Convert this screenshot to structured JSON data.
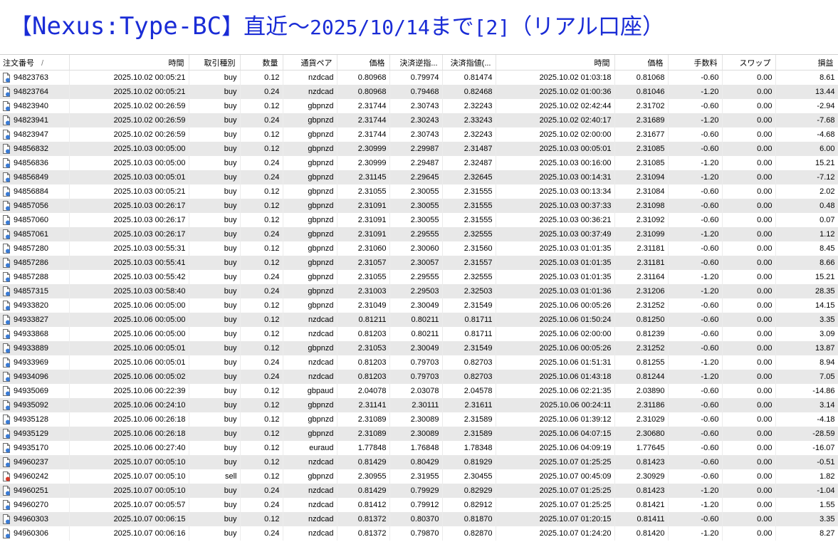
{
  "title": {
    "bracket_open": "【",
    "name": "Nexus:Type-BC",
    "bracket_close": "】",
    "prefix": "直近～",
    "date": "2025/10/14",
    "suffix": "まで",
    "page": "[2]",
    "paren_open": "（",
    "account": "リアル口座",
    "paren_close": "）"
  },
  "colors": {
    "title": "#1a2cd6",
    "buy_icon": "#3a7bd5",
    "sell_icon": "#d83a2a",
    "row_alt": "#e8e8e8"
  },
  "columns": {
    "order": "注文番号",
    "sort_indicator": "/",
    "open_time": "時間",
    "type": "取引種別",
    "volume": "数量",
    "symbol": "通貨ペア",
    "open_price": "価格",
    "sl": "決済逆指...",
    "tp": "決済指値(...",
    "close_time": "時間",
    "close_price": "価格",
    "commission": "手数料",
    "swap": "スワップ",
    "profit": "損益"
  },
  "rows": [
    {
      "order": "94823763",
      "open_time": "2025.10.02 00:05:21",
      "type": "buy",
      "volume": "0.12",
      "symbol": "nzdcad",
      "open_price": "0.80968",
      "sl": "0.79974",
      "tp": "0.81474",
      "close_time": "2025.10.02 01:03:18",
      "close_price": "0.81068",
      "commission": "-0.60",
      "swap": "0.00",
      "profit": "8.61",
      "icon": "buy-icon"
    },
    {
      "order": "94823764",
      "open_time": "2025.10.02 00:05:21",
      "type": "buy",
      "volume": "0.24",
      "symbol": "nzdcad",
      "open_price": "0.80968",
      "sl": "0.79468",
      "tp": "0.82468",
      "close_time": "2025.10.02 01:00:36",
      "close_price": "0.81046",
      "commission": "-1.20",
      "swap": "0.00",
      "profit": "13.44",
      "icon": "buy-icon"
    },
    {
      "order": "94823940",
      "open_time": "2025.10.02 00:26:59",
      "type": "buy",
      "volume": "0.12",
      "symbol": "gbpnzd",
      "open_price": "2.31744",
      "sl": "2.30743",
      "tp": "2.32243",
      "close_time": "2025.10.02 02:42:44",
      "close_price": "2.31702",
      "commission": "-0.60",
      "swap": "0.00",
      "profit": "-2.94",
      "icon": "buy-icon"
    },
    {
      "order": "94823941",
      "open_time": "2025.10.02 00:26:59",
      "type": "buy",
      "volume": "0.24",
      "symbol": "gbpnzd",
      "open_price": "2.31744",
      "sl": "2.30243",
      "tp": "2.33243",
      "close_time": "2025.10.02 02:40:17",
      "close_price": "2.31689",
      "commission": "-1.20",
      "swap": "0.00",
      "profit": "-7.68",
      "icon": "buy-icon"
    },
    {
      "order": "94823947",
      "open_time": "2025.10.02 00:26:59",
      "type": "buy",
      "volume": "0.12",
      "symbol": "gbpnzd",
      "open_price": "2.31744",
      "sl": "2.30743",
      "tp": "2.32243",
      "close_time": "2025.10.02 02:00:00",
      "close_price": "2.31677",
      "commission": "-0.60",
      "swap": "0.00",
      "profit": "-4.68",
      "icon": "buy-icon"
    },
    {
      "order": "94856832",
      "open_time": "2025.10.03 00:05:00",
      "type": "buy",
      "volume": "0.12",
      "symbol": "gbpnzd",
      "open_price": "2.30999",
      "sl": "2.29987",
      "tp": "2.31487",
      "close_time": "2025.10.03 00:05:01",
      "close_price": "2.31085",
      "commission": "-0.60",
      "swap": "0.00",
      "profit": "6.00",
      "icon": "buy-icon"
    },
    {
      "order": "94856836",
      "open_time": "2025.10.03 00:05:00",
      "type": "buy",
      "volume": "0.24",
      "symbol": "gbpnzd",
      "open_price": "2.30999",
      "sl": "2.29487",
      "tp": "2.32487",
      "close_time": "2025.10.03 00:16:00",
      "close_price": "2.31085",
      "commission": "-1.20",
      "swap": "0.00",
      "profit": "15.21",
      "icon": "buy-icon"
    },
    {
      "order": "94856849",
      "open_time": "2025.10.03 00:05:01",
      "type": "buy",
      "volume": "0.24",
      "symbol": "gbpnzd",
      "open_price": "2.31145",
      "sl": "2.29645",
      "tp": "2.32645",
      "close_time": "2025.10.03 00:14:31",
      "close_price": "2.31094",
      "commission": "-1.20",
      "swap": "0.00",
      "profit": "-7.12",
      "icon": "buy-icon"
    },
    {
      "order": "94856884",
      "open_time": "2025.10.03 00:05:21",
      "type": "buy",
      "volume": "0.12",
      "symbol": "gbpnzd",
      "open_price": "2.31055",
      "sl": "2.30055",
      "tp": "2.31555",
      "close_time": "2025.10.03 00:13:34",
      "close_price": "2.31084",
      "commission": "-0.60",
      "swap": "0.00",
      "profit": "2.02",
      "icon": "buy-icon"
    },
    {
      "order": "94857056",
      "open_time": "2025.10.03 00:26:17",
      "type": "buy",
      "volume": "0.12",
      "symbol": "gbpnzd",
      "open_price": "2.31091",
      "sl": "2.30055",
      "tp": "2.31555",
      "close_time": "2025.10.03 00:37:33",
      "close_price": "2.31098",
      "commission": "-0.60",
      "swap": "0.00",
      "profit": "0.48",
      "icon": "buy-icon"
    },
    {
      "order": "94857060",
      "open_time": "2025.10.03 00:26:17",
      "type": "buy",
      "volume": "0.12",
      "symbol": "gbpnzd",
      "open_price": "2.31091",
      "sl": "2.30055",
      "tp": "2.31555",
      "close_time": "2025.10.03 00:36:21",
      "close_price": "2.31092",
      "commission": "-0.60",
      "swap": "0.00",
      "profit": "0.07",
      "icon": "buy-icon"
    },
    {
      "order": "94857061",
      "open_time": "2025.10.03 00:26:17",
      "type": "buy",
      "volume": "0.24",
      "symbol": "gbpnzd",
      "open_price": "2.31091",
      "sl": "2.29555",
      "tp": "2.32555",
      "close_time": "2025.10.03 00:37:49",
      "close_price": "2.31099",
      "commission": "-1.20",
      "swap": "0.00",
      "profit": "1.12",
      "icon": "buy-icon"
    },
    {
      "order": "94857280",
      "open_time": "2025.10.03 00:55:31",
      "type": "buy",
      "volume": "0.12",
      "symbol": "gbpnzd",
      "open_price": "2.31060",
      "sl": "2.30060",
      "tp": "2.31560",
      "close_time": "2025.10.03 01:01:35",
      "close_price": "2.31181",
      "commission": "-0.60",
      "swap": "0.00",
      "profit": "8.45",
      "icon": "buy-icon"
    },
    {
      "order": "94857286",
      "open_time": "2025.10.03 00:55:41",
      "type": "buy",
      "volume": "0.12",
      "symbol": "gbpnzd",
      "open_price": "2.31057",
      "sl": "2.30057",
      "tp": "2.31557",
      "close_time": "2025.10.03 01:01:35",
      "close_price": "2.31181",
      "commission": "-0.60",
      "swap": "0.00",
      "profit": "8.66",
      "icon": "buy-icon"
    },
    {
      "order": "94857288",
      "open_time": "2025.10.03 00:55:42",
      "type": "buy",
      "volume": "0.24",
      "symbol": "gbpnzd",
      "open_price": "2.31055",
      "sl": "2.29555",
      "tp": "2.32555",
      "close_time": "2025.10.03 01:01:35",
      "close_price": "2.31164",
      "commission": "-1.20",
      "swap": "0.00",
      "profit": "15.21",
      "icon": "buy-icon"
    },
    {
      "order": "94857315",
      "open_time": "2025.10.03 00:58:40",
      "type": "buy",
      "volume": "0.24",
      "symbol": "gbpnzd",
      "open_price": "2.31003",
      "sl": "2.29503",
      "tp": "2.32503",
      "close_time": "2025.10.03 01:01:36",
      "close_price": "2.31206",
      "commission": "-1.20",
      "swap": "0.00",
      "profit": "28.35",
      "icon": "buy-icon"
    },
    {
      "order": "94933820",
      "open_time": "2025.10.06 00:05:00",
      "type": "buy",
      "volume": "0.12",
      "symbol": "gbpnzd",
      "open_price": "2.31049",
      "sl": "2.30049",
      "tp": "2.31549",
      "close_time": "2025.10.06 00:05:26",
      "close_price": "2.31252",
      "commission": "-0.60",
      "swap": "0.00",
      "profit": "14.15",
      "icon": "buy-icon"
    },
    {
      "order": "94933827",
      "open_time": "2025.10.06 00:05:00",
      "type": "buy",
      "volume": "0.12",
      "symbol": "nzdcad",
      "open_price": "0.81211",
      "sl": "0.80211",
      "tp": "0.81711",
      "close_time": "2025.10.06 01:50:24",
      "close_price": "0.81250",
      "commission": "-0.60",
      "swap": "0.00",
      "profit": "3.35",
      "icon": "buy-icon"
    },
    {
      "order": "94933868",
      "open_time": "2025.10.06 00:05:00",
      "type": "buy",
      "volume": "0.12",
      "symbol": "nzdcad",
      "open_price": "0.81203",
      "sl": "0.80211",
      "tp": "0.81711",
      "close_time": "2025.10.06 02:00:00",
      "close_price": "0.81239",
      "commission": "-0.60",
      "swap": "0.00",
      "profit": "3.09",
      "icon": "buy-icon"
    },
    {
      "order": "94933889",
      "open_time": "2025.10.06 00:05:01",
      "type": "buy",
      "volume": "0.12",
      "symbol": "gbpnzd",
      "open_price": "2.31053",
      "sl": "2.30049",
      "tp": "2.31549",
      "close_time": "2025.10.06 00:05:26",
      "close_price": "2.31252",
      "commission": "-0.60",
      "swap": "0.00",
      "profit": "13.87",
      "icon": "buy-icon"
    },
    {
      "order": "94933969",
      "open_time": "2025.10.06 00:05:01",
      "type": "buy",
      "volume": "0.24",
      "symbol": "nzdcad",
      "open_price": "0.81203",
      "sl": "0.79703",
      "tp": "0.82703",
      "close_time": "2025.10.06 01:51:31",
      "close_price": "0.81255",
      "commission": "-1.20",
      "swap": "0.00",
      "profit": "8.94",
      "icon": "buy-icon"
    },
    {
      "order": "94934096",
      "open_time": "2025.10.06 00:05:02",
      "type": "buy",
      "volume": "0.24",
      "symbol": "nzdcad",
      "open_price": "0.81203",
      "sl": "0.79703",
      "tp": "0.82703",
      "close_time": "2025.10.06 01:43:18",
      "close_price": "0.81244",
      "commission": "-1.20",
      "swap": "0.00",
      "profit": "7.05",
      "icon": "buy-icon"
    },
    {
      "order": "94935069",
      "open_time": "2025.10.06 00:22:39",
      "type": "buy",
      "volume": "0.12",
      "symbol": "gbpaud",
      "open_price": "2.04078",
      "sl": "2.03078",
      "tp": "2.04578",
      "close_time": "2025.10.06 02:21:35",
      "close_price": "2.03890",
      "commission": "-0.60",
      "swap": "0.00",
      "profit": "-14.86",
      "icon": "buy-icon"
    },
    {
      "order": "94935092",
      "open_time": "2025.10.06 00:24:10",
      "type": "buy",
      "volume": "0.12",
      "symbol": "gbpnzd",
      "open_price": "2.31141",
      "sl": "2.30111",
      "tp": "2.31611",
      "close_time": "2025.10.06 00:24:11",
      "close_price": "2.31186",
      "commission": "-0.60",
      "swap": "0.00",
      "profit": "3.14",
      "icon": "buy-icon"
    },
    {
      "order": "94935128",
      "open_time": "2025.10.06 00:26:18",
      "type": "buy",
      "volume": "0.12",
      "symbol": "gbpnzd",
      "open_price": "2.31089",
      "sl": "2.30089",
      "tp": "2.31589",
      "close_time": "2025.10.06 01:39:12",
      "close_price": "2.31029",
      "commission": "-0.60",
      "swap": "0.00",
      "profit": "-4.18",
      "icon": "buy-icon"
    },
    {
      "order": "94935129",
      "open_time": "2025.10.06 00:26:18",
      "type": "buy",
      "volume": "0.12",
      "symbol": "gbpnzd",
      "open_price": "2.31089",
      "sl": "2.30089",
      "tp": "2.31589",
      "close_time": "2025.10.06 04:07:15",
      "close_price": "2.30680",
      "commission": "-0.60",
      "swap": "0.00",
      "profit": "-28.59",
      "icon": "buy-icon"
    },
    {
      "order": "94935170",
      "open_time": "2025.10.06 00:27:40",
      "type": "buy",
      "volume": "0.12",
      "symbol": "euraud",
      "open_price": "1.77848",
      "sl": "1.76848",
      "tp": "1.78348",
      "close_time": "2025.10.06 04:09:19",
      "close_price": "1.77645",
      "commission": "-0.60",
      "swap": "0.00",
      "profit": "-16.07",
      "icon": "buy-icon"
    },
    {
      "order": "94960237",
      "open_time": "2025.10.07 00:05:10",
      "type": "buy",
      "volume": "0.12",
      "symbol": "nzdcad",
      "open_price": "0.81429",
      "sl": "0.80429",
      "tp": "0.81929",
      "close_time": "2025.10.07 01:25:25",
      "close_price": "0.81423",
      "commission": "-0.60",
      "swap": "0.00",
      "profit": "-0.51",
      "icon": "buy-icon"
    },
    {
      "order": "94960242",
      "open_time": "2025.10.07 00:05:10",
      "type": "sell",
      "volume": "0.12",
      "symbol": "gbpnzd",
      "open_price": "2.30955",
      "sl": "2.31955",
      "tp": "2.30455",
      "close_time": "2025.10.07 00:45:09",
      "close_price": "2.30929",
      "commission": "-0.60",
      "swap": "0.00",
      "profit": "1.82",
      "icon": "sell-icon"
    },
    {
      "order": "94960251",
      "open_time": "2025.10.07 00:05:10",
      "type": "buy",
      "volume": "0.24",
      "symbol": "nzdcad",
      "open_price": "0.81429",
      "sl": "0.79929",
      "tp": "0.82929",
      "close_time": "2025.10.07 01:25:25",
      "close_price": "0.81423",
      "commission": "-1.20",
      "swap": "0.00",
      "profit": "-1.04",
      "icon": "buy-icon"
    },
    {
      "order": "94960270",
      "open_time": "2025.10.07 00:05:57",
      "type": "buy",
      "volume": "0.24",
      "symbol": "nzdcad",
      "open_price": "0.81412",
      "sl": "0.79912",
      "tp": "0.82912",
      "close_time": "2025.10.07 01:25:25",
      "close_price": "0.81421",
      "commission": "-1.20",
      "swap": "0.00",
      "profit": "1.55",
      "icon": "buy-icon"
    },
    {
      "order": "94960303",
      "open_time": "2025.10.07 00:06:15",
      "type": "buy",
      "volume": "0.12",
      "symbol": "nzdcad",
      "open_price": "0.81372",
      "sl": "0.80370",
      "tp": "0.81870",
      "close_time": "2025.10.07 01:20:15",
      "close_price": "0.81411",
      "commission": "-0.60",
      "swap": "0.00",
      "profit": "3.35",
      "icon": "buy-icon"
    },
    {
      "order": "94960306",
      "open_time": "2025.10.07 00:06:16",
      "type": "buy",
      "volume": "0.24",
      "symbol": "nzdcad",
      "open_price": "0.81372",
      "sl": "0.79870",
      "tp": "0.82870",
      "close_time": "2025.10.07 01:24:20",
      "close_price": "0.81420",
      "commission": "-1.20",
      "swap": "0.00",
      "profit": "8.27",
      "icon": "buy-icon"
    }
  ]
}
